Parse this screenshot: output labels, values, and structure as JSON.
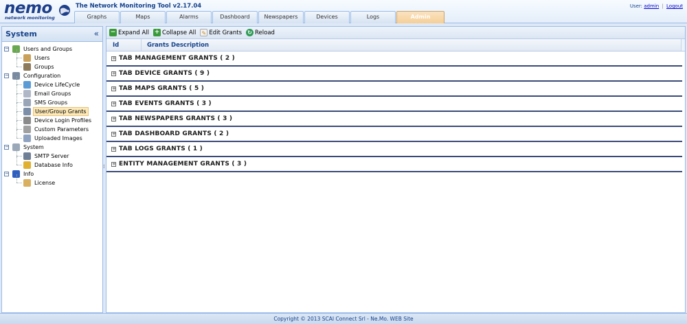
{
  "app": {
    "logo_text": "nemo",
    "logo_subtitle": "network monitoring",
    "title": "The Network Monitoring Tool v2.17.04"
  },
  "user_box": {
    "prefix": "User:",
    "user": "admin",
    "separator": "|",
    "logout": "Logout"
  },
  "tabs": [
    {
      "label": "Graphs",
      "active": false
    },
    {
      "label": "Maps",
      "active": false
    },
    {
      "label": "Alarms",
      "active": false
    },
    {
      "label": "Dashboard",
      "active": false
    },
    {
      "label": "Newspapers",
      "active": false
    },
    {
      "label": "Devices",
      "active": false
    },
    {
      "label": "Logs",
      "active": false
    },
    {
      "label": "Admin",
      "active": true
    }
  ],
  "sidebar": {
    "title": "System",
    "collapse_glyph": "«",
    "tree": [
      {
        "label": "Users and Groups",
        "level": 0,
        "icon": "users-groups-icon",
        "color": "#6aa84f"
      },
      {
        "label": "Users",
        "level": 1,
        "icon": "users-icon",
        "color": "#c9a15a"
      },
      {
        "label": "Groups",
        "level": 1,
        "icon": "groups-icon",
        "color": "#8c7a5b"
      },
      {
        "label": "Configuration",
        "level": 0,
        "icon": "configuration-icon",
        "color": "#7a8aa0"
      },
      {
        "label": "Device LifeCycle",
        "level": 1,
        "icon": "device-lifecycle-icon",
        "color": "#5b9bd5"
      },
      {
        "label": "Email Groups",
        "level": 1,
        "icon": "email-groups-icon",
        "color": "#b0b8c8"
      },
      {
        "label": "SMS Groups",
        "level": 1,
        "icon": "sms-groups-icon",
        "color": "#9aa6b8"
      },
      {
        "label": "User/Group Grants",
        "level": 1,
        "icon": "user-group-grants-icon",
        "color": "#7d8ea8",
        "selected": true
      },
      {
        "label": "Device Login Profiles",
        "level": 1,
        "icon": "device-login-profiles-icon",
        "color": "#8a8a8a"
      },
      {
        "label": "Custom Parameters",
        "level": 1,
        "icon": "custom-parameters-icon",
        "color": "#a0a0a0"
      },
      {
        "label": "Uploaded Images",
        "level": 1,
        "icon": "uploaded-images-icon",
        "color": "#8fa3c0"
      },
      {
        "label": "System",
        "level": 0,
        "icon": "system-icon",
        "color": "#9aa8b8"
      },
      {
        "label": "SMTP Server",
        "level": 1,
        "icon": "smtp-server-icon",
        "color": "#6f7f95"
      },
      {
        "label": "Database Info",
        "level": 1,
        "icon": "database-info-icon",
        "color": "#e0b030"
      },
      {
        "label": "Info",
        "level": 0,
        "icon": "info-icon",
        "color": "#2f5fbf"
      },
      {
        "label": "License",
        "level": 1,
        "icon": "license-icon",
        "color": "#d8b060"
      }
    ]
  },
  "toolbar": {
    "expand_all": "Expand All",
    "collapse_all": "Collapse All",
    "edit_grants": "Edit Grants",
    "reload": "Reload"
  },
  "grid": {
    "col_id": "Id",
    "col_desc": "Grants Description",
    "groups": [
      "TAB MANAGEMENT GRANTS ( 2 )",
      "TAB DEVICE GRANTS ( 9 )",
      "TAB MAPS GRANTS ( 5 )",
      "TAB EVENTS GRANTS ( 3 )",
      "TAB NEWSPAPERS GRANTS ( 3 )",
      "TAB DASHBOARD GRANTS ( 2 )",
      "TAB LOGS GRANTS ( 1 )",
      "ENTITY MANAGEMENT GRANTS ( 3 )"
    ]
  },
  "footer": {
    "text": "Copyright © 2013 SCAI Connect Srl - Ne.Mo. WEB Site"
  }
}
